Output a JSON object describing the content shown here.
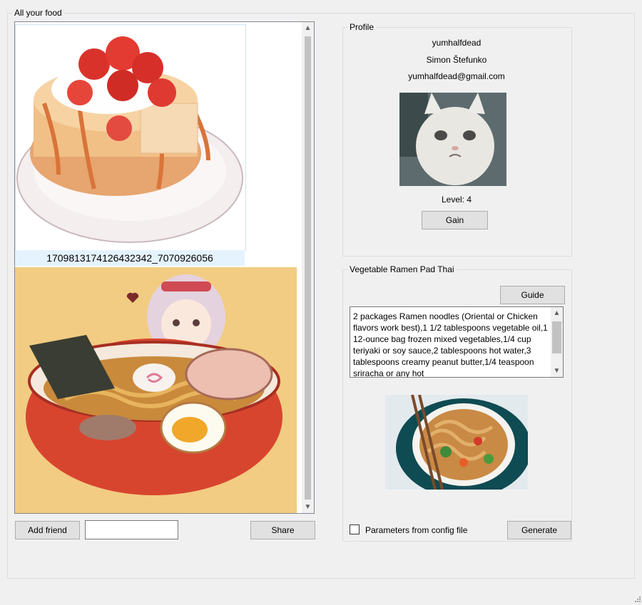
{
  "food_group": {
    "title": "All your food",
    "items": [
      {
        "label": "1709813174126432342_7070926056",
        "image": "strawberry-pancakes-illustration"
      },
      {
        "label": "",
        "image": "girl-with-ramen-illustration"
      }
    ]
  },
  "actions": {
    "add_friend_label": "Add friend",
    "friend_input_value": "",
    "share_label": "Share"
  },
  "profile": {
    "title": "Profile",
    "username": "yumhalfdead",
    "full_name": "Simon Štefunko",
    "email": "yumhalfdead@gmail.com",
    "avatar": "crying-cat-photo",
    "level_text": "Level: 4",
    "gain_label": "Gain"
  },
  "recipe": {
    "title": "Vegetable Ramen Pad Thai",
    "guide_label": "Guide",
    "ingredients": "2 packages Ramen noodles (Oriental or Chicken flavors work best),1 1/2 tablespoons vegetable oil,1 12-ounce bag frozen mixed vegetables,1/4 cup teriyaki or soy sauce,2 tablespoons hot water,3 tablespoons creamy peanut butter,1/4 teaspoon sriracha or any hot",
    "photo": "ramen-pad-thai-bowl-photo"
  },
  "generate": {
    "checkbox_label": "Parameters from config file",
    "checked": false,
    "button_label": "Generate"
  }
}
